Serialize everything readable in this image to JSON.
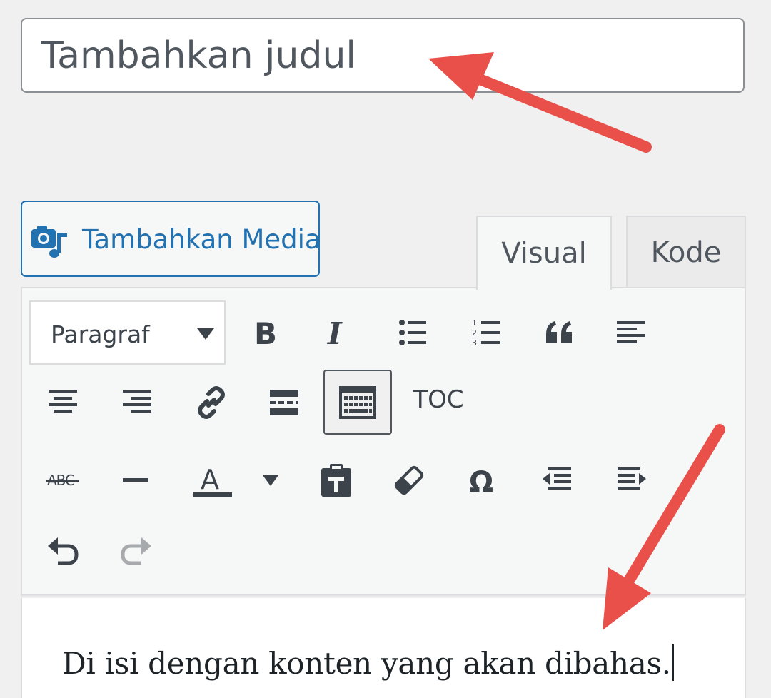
{
  "title_field": {
    "placeholder": "Tambahkan judul"
  },
  "media_button": {
    "label": "Tambahkan Media",
    "icon": "media-camera-music-icon"
  },
  "editor_tabs": [
    {
      "label": "Visual",
      "active": true
    },
    {
      "label": "Kode",
      "active": false
    }
  ],
  "toolbar": {
    "format_select": {
      "value": "Paragraf"
    },
    "toc_label": "TOC",
    "buttons": [
      "bold-icon",
      "italic-icon",
      "bulleted-list-icon",
      "numbered-list-icon",
      "blockquote-icon",
      "align-left-icon",
      "align-center-icon",
      "align-right-icon",
      "link-icon",
      "read-more-icon",
      "toolbar-toggle-icon",
      "toc",
      "strikethrough-icon",
      "horizontal-line-icon",
      "text-color-icon",
      "text-color-dropdown-icon",
      "paste-text-icon",
      "clear-formatting-icon",
      "special-character-icon",
      "outdent-icon",
      "indent-icon",
      "undo-icon",
      "redo-icon"
    ]
  },
  "editor": {
    "content": "Di isi dengan konten yang akan dibahas."
  },
  "annotation_color": "#e9504a",
  "accent_color": "#2271b1"
}
